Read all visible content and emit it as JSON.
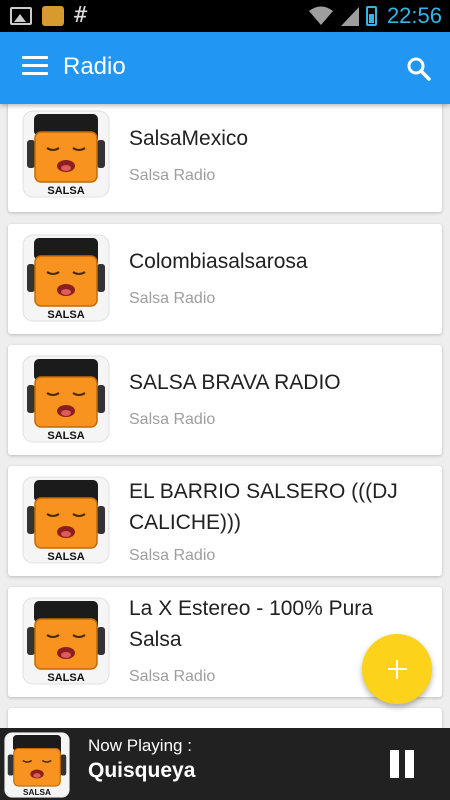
{
  "status_bar": {
    "time": "22:56",
    "hash": "#",
    "icons": [
      "image-notification-icon",
      "app-notification-icon",
      "wifi-icon",
      "signal-icon",
      "battery-icon"
    ]
  },
  "app_bar": {
    "title": "Radio",
    "menu_icon": "menu-icon",
    "search_icon": "search-icon",
    "color": "#2196f3"
  },
  "logo": {
    "label": "SALSA",
    "face_color": "#f7931e"
  },
  "stations": [
    {
      "name": "SalsaMexico",
      "genre": "Salsa Radio"
    },
    {
      "name": "Colombiasalsarosa",
      "genre": "Salsa Radio"
    },
    {
      "name": "SALSA BRAVA RADIO",
      "genre": "Salsa Radio"
    },
    {
      "name": "EL BARRIO SALSERO (((DJ CALICHE)))",
      "genre": "Salsa Radio"
    },
    {
      "name": "La X Estereo - 100% Pura Salsa",
      "genre": "Salsa Radio"
    }
  ],
  "fab": {
    "icon": "plus-icon",
    "color": "#fdd21b"
  },
  "player": {
    "label": "Now Playing :",
    "station": "Quisqueya",
    "button_icon": "pause-icon"
  }
}
